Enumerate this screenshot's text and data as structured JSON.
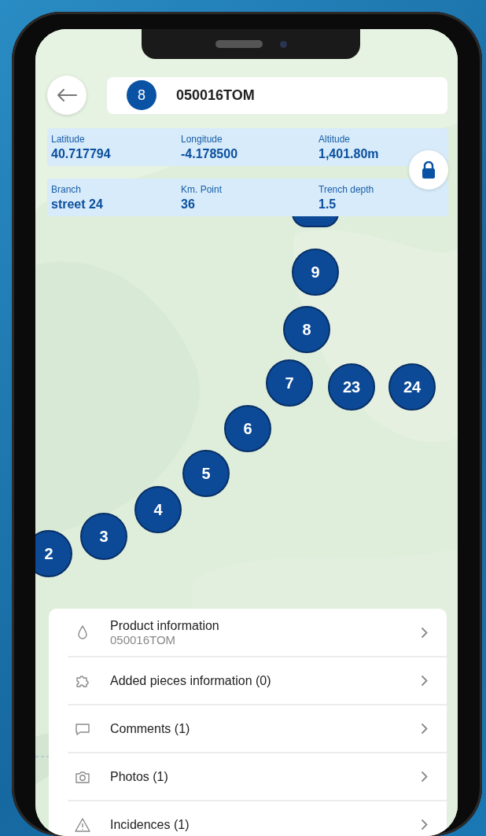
{
  "header": {
    "badge": "8",
    "title": "050016TOM"
  },
  "info_rows": [
    [
      {
        "label": "Latitude",
        "value": "40.717794"
      },
      {
        "label": "Longitude",
        "value": "-4.178500"
      },
      {
        "label": "Altitude",
        "value": "1,401.80m"
      }
    ],
    [
      {
        "label": "Branch",
        "value": "street 24"
      },
      {
        "label": "Km. Point",
        "value": "36"
      },
      {
        "label": "Trench depth",
        "value": "1.5"
      }
    ]
  ],
  "map": {
    "kind": "picture",
    "markers": [
      "9",
      "8",
      "7",
      "23",
      "24",
      "6",
      "5",
      "4",
      "3",
      "2"
    ]
  },
  "menu": [
    {
      "kind": "drop",
      "title": "Product information",
      "subtitle": "050016TOM"
    },
    {
      "kind": "puzzle",
      "title": "Added pieces information (0)"
    },
    {
      "kind": "comment",
      "title": "Comments (1)"
    },
    {
      "kind": "camera",
      "title": "Photos (1)"
    },
    {
      "kind": "warning",
      "title": "Incidences (1)"
    }
  ]
}
